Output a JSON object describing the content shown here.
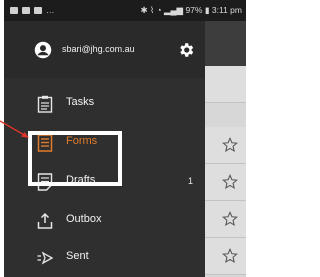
{
  "status_bar": {
    "time": "3:11 pm",
    "battery": "97%",
    "notification_dots": "…"
  },
  "drawer": {
    "account_email": "sbari@jhg.com.au",
    "items": [
      {
        "label": "Tasks",
        "icon": "clipboard-icon",
        "count": ""
      },
      {
        "label": "Forms",
        "icon": "form-icon",
        "count": "",
        "active": true
      },
      {
        "label": "Drafts",
        "icon": "draft-icon",
        "count": "1"
      },
      {
        "label": "Outbox",
        "icon": "outbox-icon",
        "count": ""
      },
      {
        "label": "Sent",
        "icon": "send-icon",
        "count": ""
      }
    ]
  },
  "colors": {
    "accent": "#e07b2c",
    "drawer_bg": "#2f2f2f",
    "annotation": "#e0342a"
  }
}
